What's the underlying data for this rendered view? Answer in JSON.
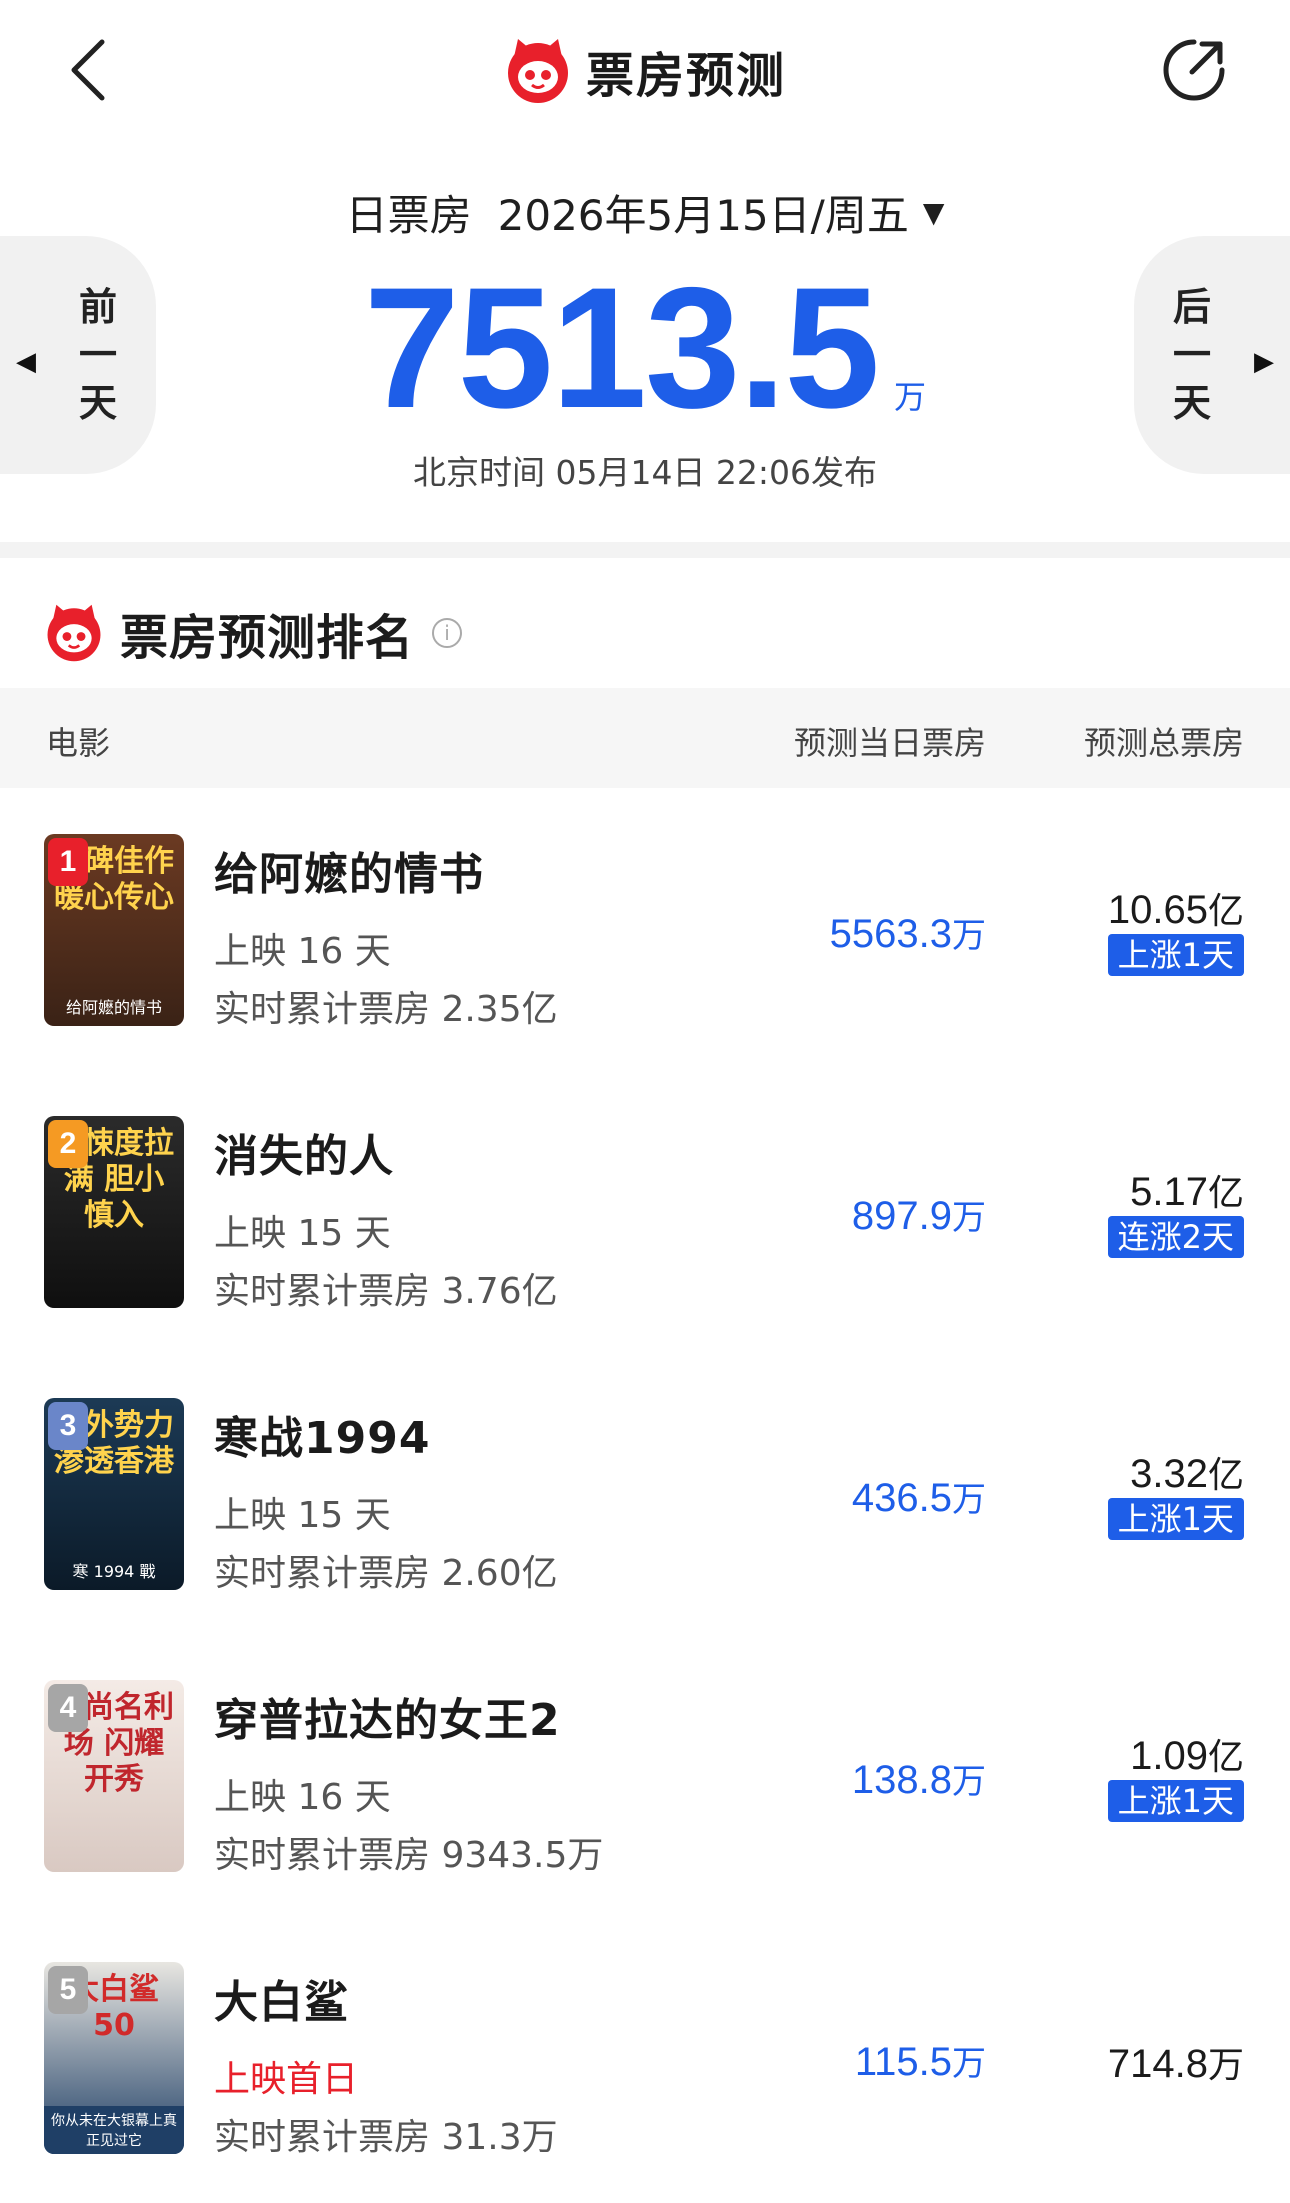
{
  "header": {
    "title": "票房预测",
    "back_icon": "chevron-left-icon",
    "share_icon": "share-icon",
    "logo_icon": "cat-logo-icon"
  },
  "date_selector": {
    "label": "日票房",
    "value": "2026年5月15日/周五",
    "caret": "▼"
  },
  "nav": {
    "prev": [
      "前",
      "一",
      "天"
    ],
    "next": [
      "后",
      "一",
      "天"
    ]
  },
  "forecast": {
    "value": "7513.5",
    "unit": "万",
    "published": "北京时间  05月14日  22:06发布"
  },
  "ranking": {
    "title": "票房预测排名",
    "info_icon": "i",
    "columns": {
      "movie": "电影",
      "today": "预测当日票房",
      "total": "预测总票房"
    },
    "movies": [
      {
        "rank": "1",
        "rank_color": "#e8202b",
        "title": "给阿嬷的情书",
        "days": "上映 16 天",
        "cumulative": "实时累计票房 2.35亿",
        "today": "5563.3",
        "today_unit": "万",
        "total": "10.65",
        "total_unit": "亿",
        "trend": "上涨1天",
        "poster_text": "口碑佳作 暖心传心",
        "poster_caption": "给阿嬷的情书",
        "poster_colors": [
          "#6b3a22",
          "#3a2216"
        ]
      },
      {
        "rank": "2",
        "rank_color": "#f59a23",
        "title": "消失的人",
        "days": "上映 15 天",
        "cumulative": "实时累计票房 3.76亿",
        "today": "897.9",
        "today_unit": "万",
        "total": "5.17",
        "total_unit": "亿",
        "trend": "连涨2天",
        "poster_text": "惊悚度拉满 胆小慎入",
        "poster_caption": "",
        "poster_colors": [
          "#2b2b2b",
          "#0f0f0f"
        ]
      },
      {
        "rank": "3",
        "rank_color": "#6a86c9",
        "title": "寒战1994",
        "days": "上映 15 天",
        "cumulative": "实时累计票房 2.60亿",
        "today": "436.5",
        "today_unit": "万",
        "total": "3.32",
        "total_unit": "亿",
        "trend": "上涨1天",
        "poster_text": "境外势力 渗透香港",
        "poster_caption": "寒 1994 戰",
        "poster_colors": [
          "#1c3a55",
          "#0b1a28"
        ]
      },
      {
        "rank": "4",
        "rank_color": "#a6a6a6",
        "title": "穿普拉达的女王2",
        "days": "上映 16 天",
        "cumulative": "实时累计票房 9343.5万",
        "today": "138.8",
        "today_unit": "万",
        "total": "1.09",
        "total_unit": "亿",
        "trend": "上涨1天",
        "poster_text": "时尚名利场 闪耀开秀",
        "poster_caption": "",
        "poster_colors": [
          "#f4ebe6",
          "#d9c9c2"
        ]
      },
      {
        "rank": "5",
        "rank_color": "#a6a6a6",
        "title": "大白鲨",
        "days": "上映首日",
        "days_highlight": true,
        "cumulative": "实时累计票房 31.3万",
        "today": "115.5",
        "today_unit": "万",
        "total": "714.8",
        "total_unit": "万",
        "trend": "",
        "poster_text": "大白鲨 50",
        "poster_caption": "你从未在大银幕上真正见过它",
        "poster_colors": [
          "#e8e6e1",
          "#1f3f66"
        ]
      }
    ]
  }
}
